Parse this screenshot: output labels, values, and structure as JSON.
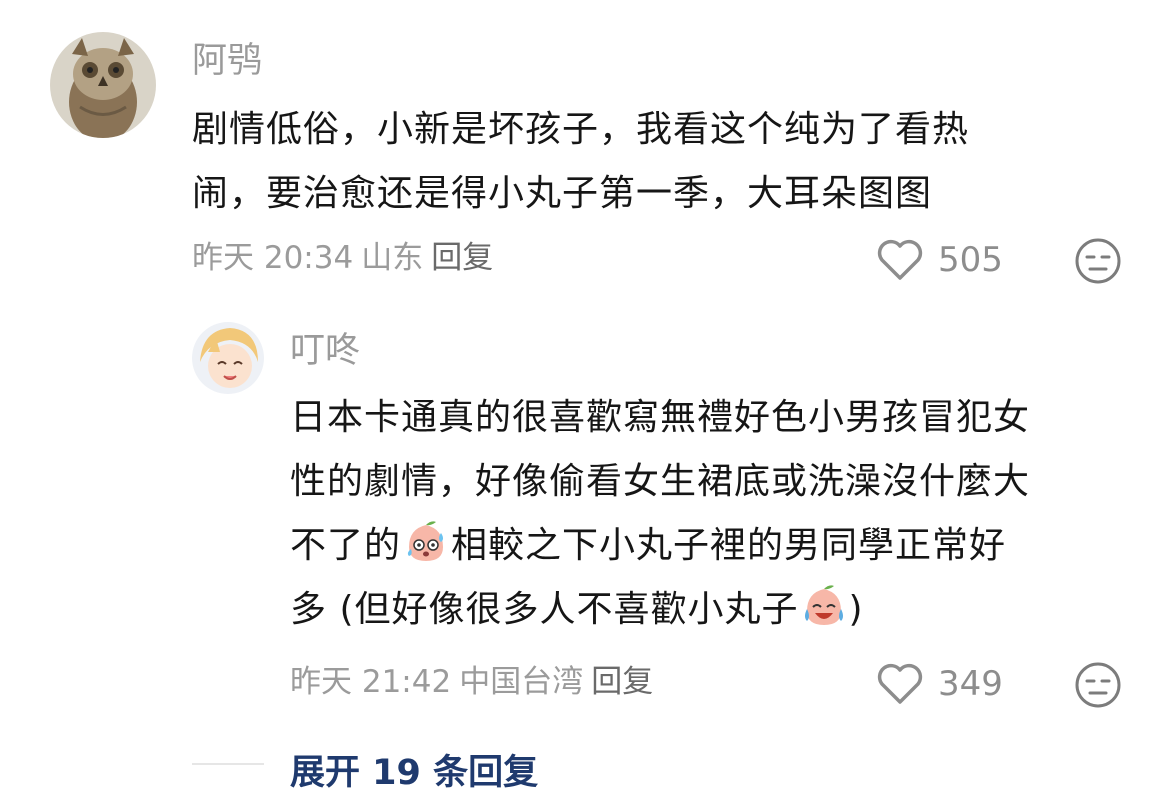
{
  "comment": {
    "username": "阿鸮",
    "lines": [
      "剧情低俗，小新是坏孩子，我看这个纯为了看热",
      "闹，要治愈还是得小丸子第一季，大耳朵图图"
    ],
    "time": "昨天 20:34",
    "location": "山东",
    "reply_label": "回复",
    "likes": "505",
    "avatar_icon": "owl-avatar",
    "face_icon": "neutral-face-icon"
  },
  "reply": {
    "username": "叮咚",
    "line1": "日本卡通真的很喜歡寫無禮好色小男孩冒犯女",
    "line2": "性的劇情，好像偷看女生裙底或洗澡沒什麼大",
    "line3_a": "不了的",
    "line3_b": "相較之下小丸子裡的男同學正常好",
    "line4_a": "多 (但好像很多人不喜歡小丸子",
    "line4_b": ")",
    "time": "昨天 21:42",
    "location": "中国台湾",
    "reply_label": "回复",
    "likes": "349",
    "avatar_icon": "anime-boy-avatar",
    "emoji_1": "sweating-peach-emoji",
    "emoji_2": "crying-laughing-peach-emoji"
  },
  "expand": {
    "label": "展开 19 条回复"
  },
  "colors": {
    "text": "#161616",
    "meta": "#9b9b9b",
    "expand_link": "#1f3a6e"
  }
}
